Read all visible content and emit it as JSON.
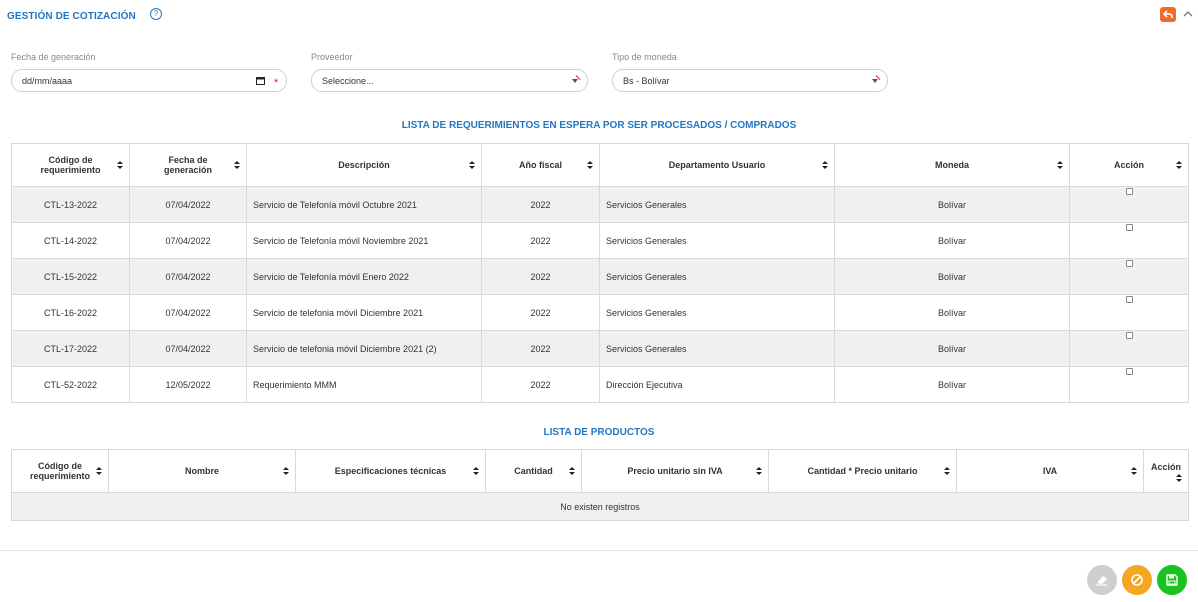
{
  "header": {
    "title": "GESTIÓN DE COTIZACIÓN",
    "help_glyph": "?",
    "back_icon": "undo-icon",
    "collapse_icon": "chevron-up-icon"
  },
  "filters": {
    "fecha": {
      "label": "Fecha de generación",
      "value": "dd/mm/aaaa",
      "required_mark": "*"
    },
    "proveedor": {
      "label": "Proveedor",
      "value": "Seleccione..."
    },
    "moneda": {
      "label": "Tipo de moneda",
      "value": "Bs - Bolívar"
    }
  },
  "requerimientos": {
    "title": "LISTA DE REQUERIMIENTOS EN ESPERA POR SER PROCESADOS / COMPRADOS",
    "headers": [
      "Código de requerimiento",
      "Fecha de generación",
      "Descripción",
      "Año fiscal",
      "Departamento Usuario",
      "Moneda",
      "Acción"
    ],
    "rows": [
      [
        "CTL-13-2022",
        "07/04/2022",
        "Servicio de Telefonía móvil Octubre 2021",
        "2022",
        "Servicios Generales",
        "Bolívar"
      ],
      [
        "CTL-14-2022",
        "07/04/2022",
        "Servicio de Telefonía móvil Noviembre 2021",
        "2022",
        "Servicios Generales",
        "Bolívar"
      ],
      [
        "CTL-15-2022",
        "07/04/2022",
        "Servicio de Telefonía móvil Enero 2022",
        "2022",
        "Servicios Generales",
        "Bolívar"
      ],
      [
        "CTL-16-2022",
        "07/04/2022",
        "Servicio de telefonia móvil Diciembre 2021",
        "2022",
        "Servicios Generales",
        "Bolívar"
      ],
      [
        "CTL-17-2022",
        "07/04/2022",
        "Servicio de telefonia móvil Diciembre 2021 (2)",
        "2022",
        "Servicios Generales",
        "Bolívar"
      ],
      [
        "CTL-52-2022",
        "12/05/2022",
        "Requerimiento MMM",
        "2022",
        "Dirección Ejecutiva",
        "Bolívar"
      ]
    ]
  },
  "productos": {
    "title": "LISTA DE PRODUCTOS",
    "headers": [
      "Código de requerimiento",
      "Nombre",
      "Especificaciones técnicas",
      "Cantidad",
      "Precio unitario sin IVA",
      "Cantidad * Precio unitario",
      "IVA",
      "Acción"
    ],
    "empty_text": "No existen registros"
  },
  "actions": {
    "clear_icon": "eraser-icon",
    "cancel_icon": "cancel-icon",
    "save_icon": "save-icon",
    "colors": {
      "clear": "#cfcfcf",
      "cancel": "#f5a623",
      "save": "#18c21f",
      "accent": "#2376c4"
    }
  }
}
